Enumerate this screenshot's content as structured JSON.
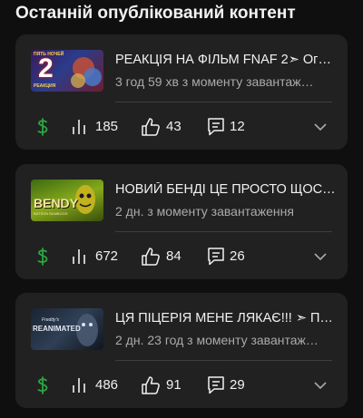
{
  "section": {
    "title": "Останній опублікований контент"
  },
  "colors": {
    "money": "#2ba640",
    "text": "#f1f1f1",
    "secondary": "#aaaaaa",
    "card": "#212121"
  },
  "videos": [
    {
      "thumb_text_top": "ПЯТЬ НОЧЕЙ",
      "thumb_text_big": "2",
      "thumb_text_bottom": "РЕАКЦИЯ",
      "title": "РЕАКЦІЯ НА ФІЛЬМ FNAF 2➣ Ог…",
      "meta": "3 год 59 хв з моменту завантаж…",
      "views": "185",
      "likes": "43",
      "comments": "12"
    },
    {
      "thumb_text_big": "BENDY",
      "thumb_text_bottom": "BATSON BAMBOOS",
      "title": "НОВИЙ БЕНДІ ЦЕ ПРОСТО ЩОС…",
      "meta": "2 дн. з моменту завантаження",
      "views": "672",
      "likes": "84",
      "comments": "26"
    },
    {
      "thumb_text_top": "Freddy's",
      "thumb_text_big": "REANIMATED",
      "title": "ЦЯ ПІЦЕРІЯ МЕНЕ ЛЯКАЄ!!! ➣ П…",
      "meta": "2 дн. 23 год з моменту завантаж…",
      "views": "486",
      "likes": "91",
      "comments": "29"
    }
  ]
}
